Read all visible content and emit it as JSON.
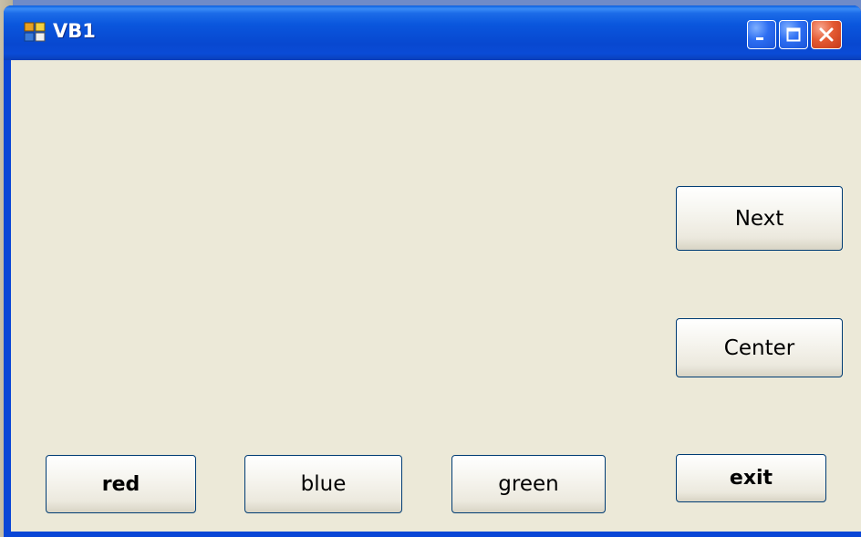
{
  "window": {
    "title": "VB1",
    "icon": "app-window-icon",
    "controls": {
      "minimize_icon": "minimize-icon",
      "maximize_icon": "maximize-icon",
      "close_icon": "close-icon"
    }
  },
  "form": {
    "buttons": {
      "next": "Next",
      "center": "Center",
      "exit": "exit",
      "red": "red",
      "blue": "blue",
      "green": "green"
    }
  },
  "colors": {
    "titlebar": "#0a56dd",
    "client_bg": "#ece9d8",
    "close_button": "#e45a32",
    "button_border": "#003c74"
  }
}
